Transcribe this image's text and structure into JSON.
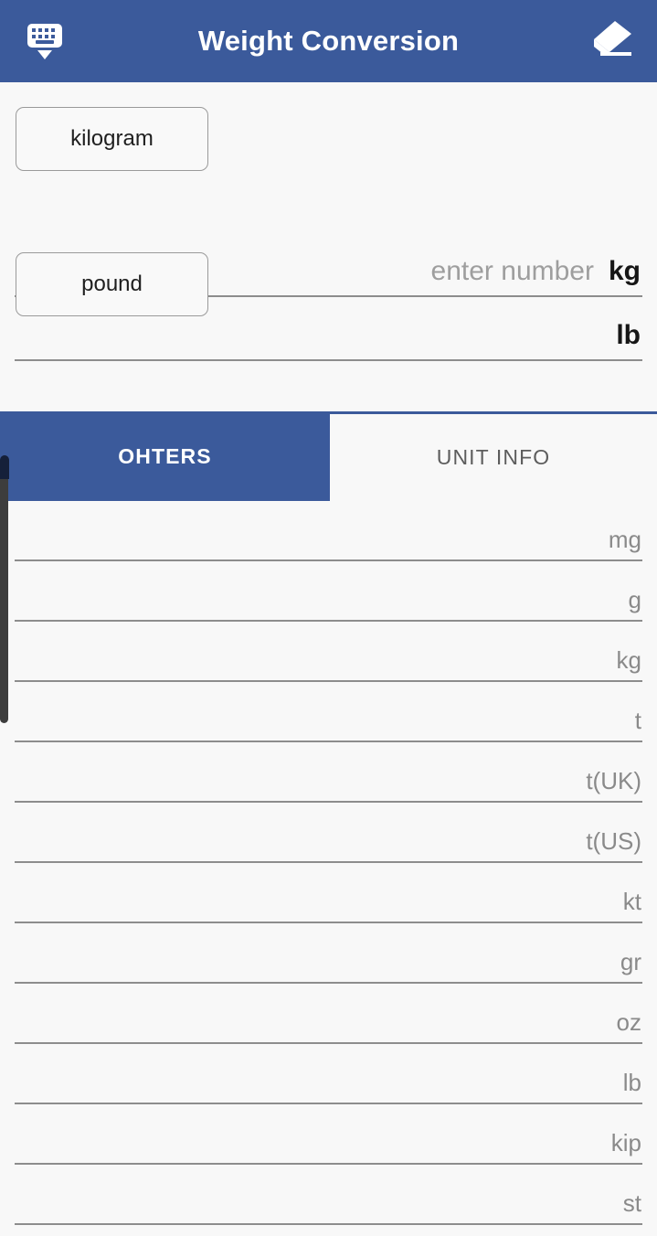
{
  "appbar": {
    "title": "Weight Conversion",
    "left_icon": "keyboard-hide-icon",
    "right_icon": "eraser-icon",
    "background_color": "#3b5a9b",
    "text_color": "#ffffff"
  },
  "converter": {
    "from": {
      "unit_button_label": "kilogram",
      "value": "",
      "placeholder": "enter number",
      "symbol": "kg"
    },
    "to": {
      "unit_button_label": "pound",
      "value": "",
      "placeholder": "",
      "symbol": "lb"
    }
  },
  "tabs": [
    {
      "label": "OHTERS",
      "active": true
    },
    {
      "label": "UNIT INFO",
      "active": false
    }
  ],
  "unit_list": [
    {
      "symbol": "mg",
      "value": ""
    },
    {
      "symbol": "g",
      "value": ""
    },
    {
      "symbol": "kg",
      "value": ""
    },
    {
      "symbol": "t",
      "value": ""
    },
    {
      "symbol": "t(UK)",
      "value": ""
    },
    {
      "symbol": "t(US)",
      "value": ""
    },
    {
      "symbol": "kt",
      "value": ""
    },
    {
      "symbol": "gr",
      "value": ""
    },
    {
      "symbol": "oz",
      "value": ""
    },
    {
      "symbol": "lb",
      "value": ""
    },
    {
      "symbol": "kip",
      "value": ""
    },
    {
      "symbol": "st",
      "value": ""
    }
  ],
  "colors": {
    "accent": "#3b5a9b",
    "background": "#f8f8f8",
    "divider": "#8d8d8d",
    "muted_text": "#8a8a8a",
    "placeholder_text": "#9e9e9e",
    "scroll_indicator": "#3d3d3d"
  }
}
